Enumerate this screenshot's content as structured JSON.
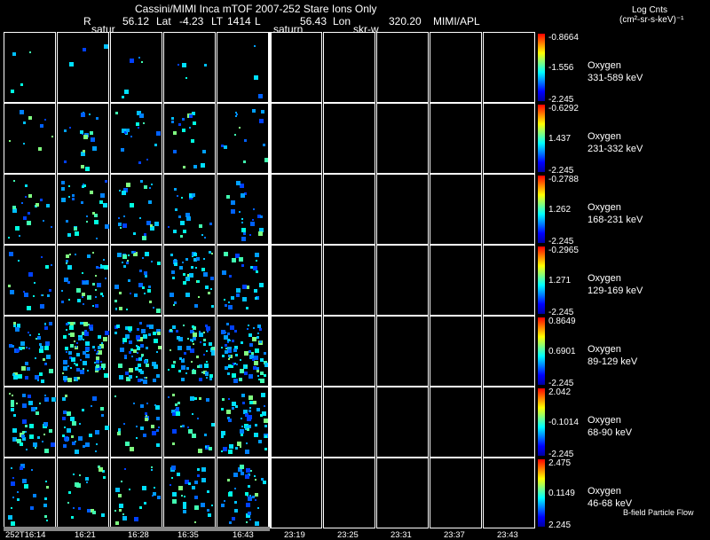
{
  "header": {
    "title": "Cassini/MIMI Inca mTOF  2007-252   Stare   Ions Only",
    "line2_r_label": "R",
    "line2_r_value": "56.12",
    "line2_lat_label": "Lat",
    "line2_lat_value": "-4.23",
    "line2_lt_label": "LT",
    "line2_lt_value": "1414",
    "line2_l_label": "L",
    "line2_l_value": "56.43",
    "line2_lon_label": "Lon",
    "line2_lon_value": "320.20",
    "line2_source": "MIMI/APL",
    "label_satur": "satur",
    "label_saturn": "saturn",
    "label_skr": "skr-w",
    "units_title": "Log Cnts",
    "units_expr": "(cm²-sr-s-keV)⁻¹"
  },
  "bands": [
    {
      "species": "Oxygen",
      "energy": "331-589 keV",
      "cb_max": "-0.8664",
      "cb_mid": "-1.556",
      "cb_min": "-2.245"
    },
    {
      "species": "Oxygen",
      "energy": "231-332 keV",
      "cb_max": "-0.6292",
      "cb_mid": "1.437",
      "cb_min": "-2.245"
    },
    {
      "species": "Oxygen",
      "energy": "168-231 keV",
      "cb_max": "-0.2788",
      "cb_mid": "1.262",
      "cb_min": "-2.245"
    },
    {
      "species": "Oxygen",
      "energy": "129-169 keV",
      "cb_max": "-0.2965",
      "cb_mid": "1.271",
      "cb_min": "-2.245"
    },
    {
      "species": "Oxygen",
      "energy": "89-129 keV",
      "cb_max": "0.8649",
      "cb_mid": "0.6901",
      "cb_min": "-2.245"
    },
    {
      "species": "Oxygen",
      "energy": "68-90 keV",
      "cb_max": "2.042",
      "cb_mid": "-0.1014",
      "cb_min": "-2.245"
    },
    {
      "species": "Oxygen",
      "energy": "46-68 keV",
      "cb_max": "2.475",
      "cb_mid": "0.1149",
      "cb_min": "2.245"
    }
  ],
  "bfield_label": "B-field Particle Flow",
  "time_ticks": [
    "252T16:14",
    "16:21",
    "16:28",
    "16:35",
    "16:43",
    "23:19",
    "23:25",
    "23:31",
    "23:37",
    "23:43"
  ],
  "colors": {
    "background": "#000000",
    "grid": "#ffffff",
    "colorbar_stops": [
      "#0000a0",
      "#0000ff",
      "#0080ff",
      "#00ffff",
      "#80ff80",
      "#ffff00",
      "#ff8000",
      "#ff0000"
    ]
  },
  "icons": {
    "flow": "particle-flow-bar"
  }
}
